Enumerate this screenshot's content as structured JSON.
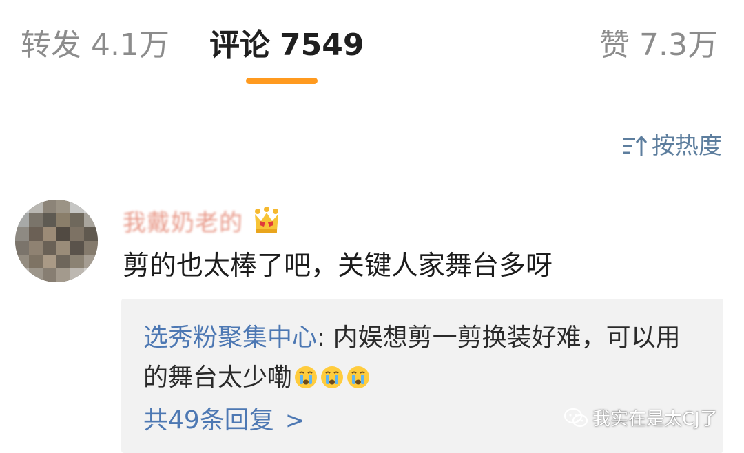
{
  "tabs": {
    "forward": {
      "label": "转发",
      "count": "4.1万"
    },
    "comments": {
      "label": "评论",
      "count": "7549"
    },
    "likes": {
      "label": "赞",
      "count": "7.3万"
    }
  },
  "sort": {
    "label": "按热度"
  },
  "comment": {
    "username": "我戴奶老的",
    "text": "剪的也太棒了吧，关键人家舞台多呀",
    "reply": {
      "author": "选秀粉聚集中心",
      "separator": ": ",
      "text": "内娱想剪一剪换装好难，可以用的舞台太少嘞"
    },
    "more_replies": "共49条回复",
    "more_replies_chevron": ">"
  },
  "watermark": {
    "text": "我实在是太CJ了",
    "icon": "wechat-icon"
  },
  "colors": {
    "accent_underline": "#ff9a1f",
    "link_blue": "#4d78b3",
    "sort_blue": "#5d7e9e"
  }
}
